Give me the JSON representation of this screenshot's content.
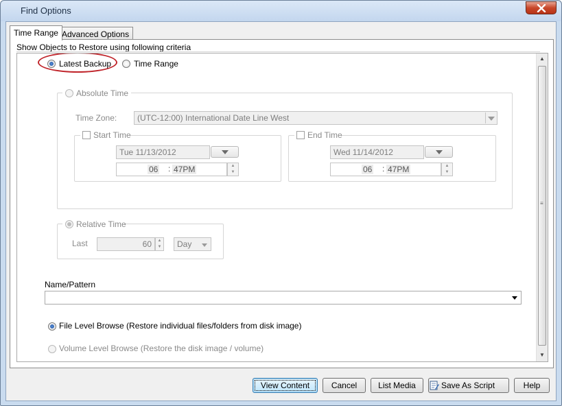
{
  "window": {
    "title": "Find Options"
  },
  "tabs": [
    {
      "label": "Time Range",
      "active": true
    },
    {
      "label": "Advanced Options",
      "active": false
    }
  ],
  "criteria_label": "Show Objects to Restore using following criteria",
  "mode": {
    "latest_backup": {
      "label": "Latest Backup",
      "selected": true
    },
    "time_range": {
      "label": "Time Range",
      "selected": false
    }
  },
  "absolute_time": {
    "label": "Absolute Time",
    "time_zone_label": "Time Zone:",
    "time_zone_value": "(UTC-12:00) International Date Line West",
    "start": {
      "label": "Start Time",
      "date": "Tue 11/13/2012",
      "hour": "06",
      "sep": ":",
      "minute": "47PM"
    },
    "end": {
      "label": "End Time",
      "date": "Wed 11/14/2012",
      "hour": "06",
      "sep": ":",
      "minute": "47PM"
    }
  },
  "relative_time": {
    "label": "Relative Time",
    "last_label": "Last",
    "last_value": "60",
    "unit": "Day"
  },
  "name_pattern": {
    "label": "Name/Pattern",
    "value": ""
  },
  "browse": {
    "file_level": {
      "label": "File Level Browse (Restore individual files/folders from disk image)",
      "selected": true
    },
    "volume_level": {
      "label": "Volume Level Browse (Restore the disk image / volume)",
      "selected": false
    }
  },
  "buttons": {
    "view_content": "View Content",
    "cancel": "Cancel",
    "list_media": "List Media",
    "save_as_script": "Save As Script",
    "help": "Help"
  },
  "colors": {
    "highlight": "#c0242a",
    "accent": "#1c4f9c"
  }
}
